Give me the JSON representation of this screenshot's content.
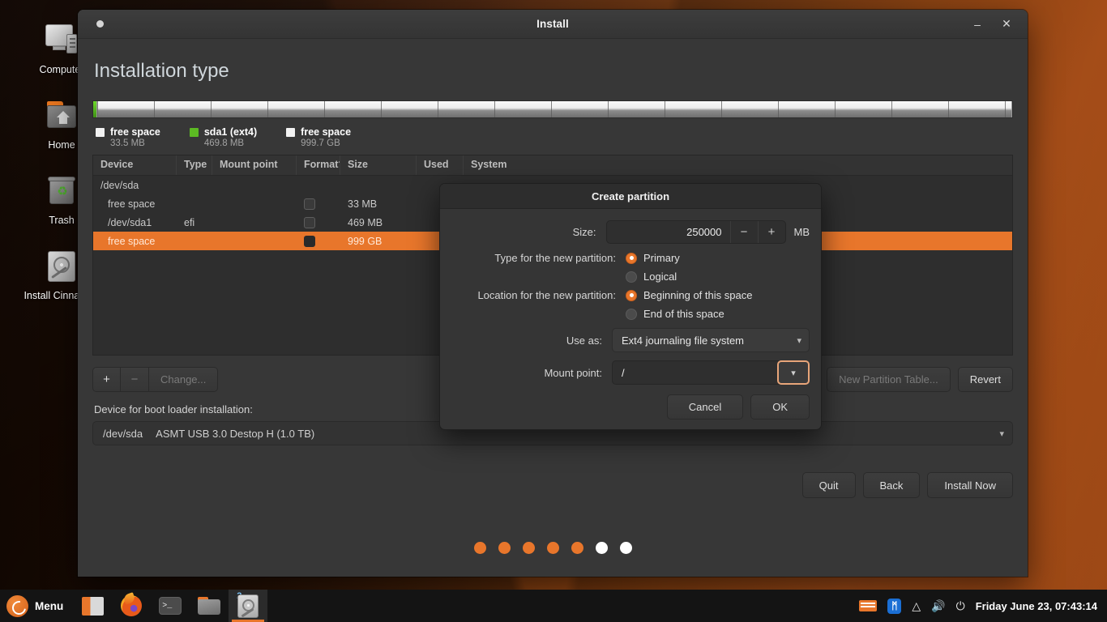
{
  "desktop": {
    "icons": [
      {
        "name": "Computer",
        "icon": "computer-icon"
      },
      {
        "name": "Home",
        "icon": "home-folder-icon"
      },
      {
        "name": "Trash",
        "icon": "trash-icon"
      },
      {
        "name": "Install Cinnamon",
        "icon": "install-disc-icon"
      }
    ]
  },
  "window": {
    "title": "Install",
    "minimize_label": "–",
    "close_label": "✕",
    "page_title": "Installation type"
  },
  "legend": [
    {
      "label": "free space",
      "size": "33.5 MB",
      "color": "#f2f2f2"
    },
    {
      "label": "sda1 (ext4)",
      "size": "469.8 MB",
      "color": "#5cba23"
    },
    {
      "label": "free space",
      "size": "999.7 GB",
      "color": "#f2f2f2"
    }
  ],
  "partition_table": {
    "headers": [
      "Device",
      "Type",
      "Mount point",
      "Format?",
      "Size",
      "Used",
      "System"
    ],
    "rows": [
      {
        "device": "/dev/sda",
        "type": "",
        "mount": "",
        "format": false,
        "size": "",
        "used": "",
        "system": "",
        "indent": false,
        "selected": false,
        "show_checkbox": false
      },
      {
        "device": "free space",
        "type": "",
        "mount": "",
        "format": false,
        "size": "33 MB",
        "used": "",
        "system": "",
        "indent": true,
        "selected": false,
        "show_checkbox": true
      },
      {
        "device": "/dev/sda1",
        "type": "efi",
        "mount": "",
        "format": false,
        "size": "469 MB",
        "used": "",
        "system": "",
        "indent": true,
        "selected": false,
        "show_checkbox": true
      },
      {
        "device": "free space",
        "type": "",
        "mount": "",
        "format": false,
        "size": "999 GB",
        "used": "",
        "system": "",
        "indent": true,
        "selected": true,
        "show_checkbox": true
      }
    ]
  },
  "toolbar": {
    "add_label": "+",
    "remove_label": "−",
    "change_label": "Change...",
    "new_partition_table_label": "New Partition Table...",
    "revert_label": "Revert"
  },
  "bootloader": {
    "label": "Device for boot loader installation:",
    "device": "/dev/sda",
    "description": "ASMT USB 3.0 Destop H (1.0 TB)"
  },
  "nav": {
    "quit_label": "Quit",
    "back_label": "Back",
    "install_label": "Install Now"
  },
  "progress_dots": {
    "total": 7,
    "completed": 5
  },
  "dialog": {
    "title": "Create partition",
    "size_label": "Size:",
    "size_value": "250000",
    "size_unit": "MB",
    "decrement_label": "−",
    "increment_label": "+",
    "type_label": "Type for the new partition:",
    "type_options": [
      {
        "label": "Primary",
        "selected": true
      },
      {
        "label": "Logical",
        "selected": false
      }
    ],
    "location_label": "Location for the new partition:",
    "location_options": [
      {
        "label": "Beginning of this space",
        "selected": true
      },
      {
        "label": "End of this space",
        "selected": false
      }
    ],
    "use_as_label": "Use as:",
    "use_as_value": "Ext4 journaling file system",
    "mount_point_label": "Mount point:",
    "mount_point_value": "/",
    "cancel_label": "Cancel",
    "ok_label": "OK"
  },
  "taskbar": {
    "menu_label": "Menu",
    "launchers": [
      {
        "name": "files-launcher",
        "icon": "files-icon"
      },
      {
        "name": "firefox-launcher",
        "icon": "firefox-icon"
      },
      {
        "name": "terminal-launcher",
        "icon": "terminal-icon",
        "prompt": ">_"
      },
      {
        "name": "file-manager-launcher",
        "icon": "folder-icon"
      },
      {
        "name": "installer-window",
        "icon": "disk-icon",
        "badge": "2",
        "active": true
      }
    ],
    "tray": {
      "bluetooth_glyph": "ᛗ",
      "clock": "Friday June 23, 07:43:14"
    }
  },
  "colors": {
    "accent": "#e8762b",
    "selection": "#e8762b",
    "window_bg": "#373737",
    "dialog_bg": "#353535",
    "ext4_green": "#5cba23"
  }
}
